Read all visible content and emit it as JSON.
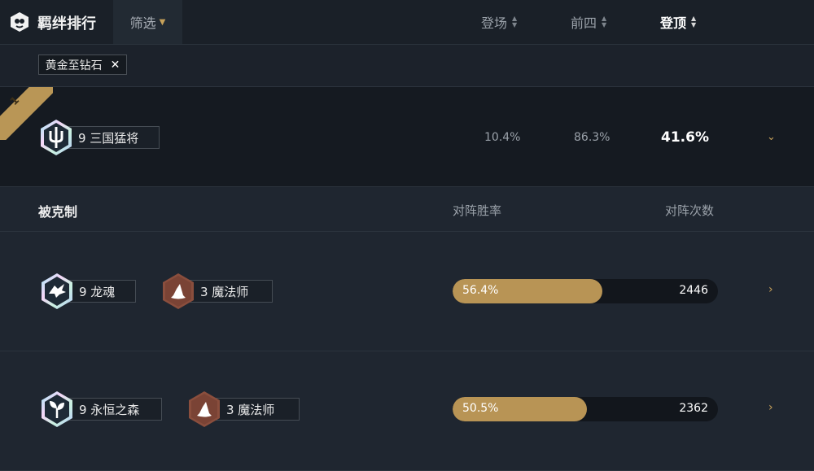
{
  "header": {
    "title": "羁绊排行",
    "filter_label": "筛选",
    "sort_columns": [
      {
        "label": "登场",
        "active": false
      },
      {
        "label": "前四",
        "active": false
      },
      {
        "label": "登顶",
        "active": true
      }
    ]
  },
  "filters": {
    "tag_label": "黄金至钻石",
    "tag_remove_glyph": "✕"
  },
  "top_trait": {
    "rank": "1",
    "trait_label": "9 三国猛将",
    "icon": "trident-icon",
    "appearance": "10.4%",
    "top4": "86.3%",
    "win": "41.6%"
  },
  "counters": {
    "title": "被克制",
    "col_winrate": "对阵胜率",
    "col_count": "对阵次数",
    "rows": [
      {
        "traits": [
          {
            "label": "9 龙魂",
            "icon": "dragon-icon",
            "style": "prismatic"
          },
          {
            "label": "3 魔法师",
            "icon": "wizard-hat-icon",
            "style": "bronze"
          }
        ],
        "winrate_text": "56.4%",
        "winrate": 56.4,
        "count": "2446"
      },
      {
        "traits": [
          {
            "label": "9 永恒之森",
            "icon": "sprout-icon",
            "style": "prismatic"
          },
          {
            "label": "3 魔法师",
            "icon": "wizard-hat-icon",
            "style": "bronze"
          }
        ],
        "winrate_text": "50.5%",
        "winrate": 50.5,
        "count": "2362"
      }
    ]
  },
  "colors": {
    "accent_gold": "#b89455",
    "bronze_hex": "#8a4e3d",
    "bg": "#1e252e"
  }
}
